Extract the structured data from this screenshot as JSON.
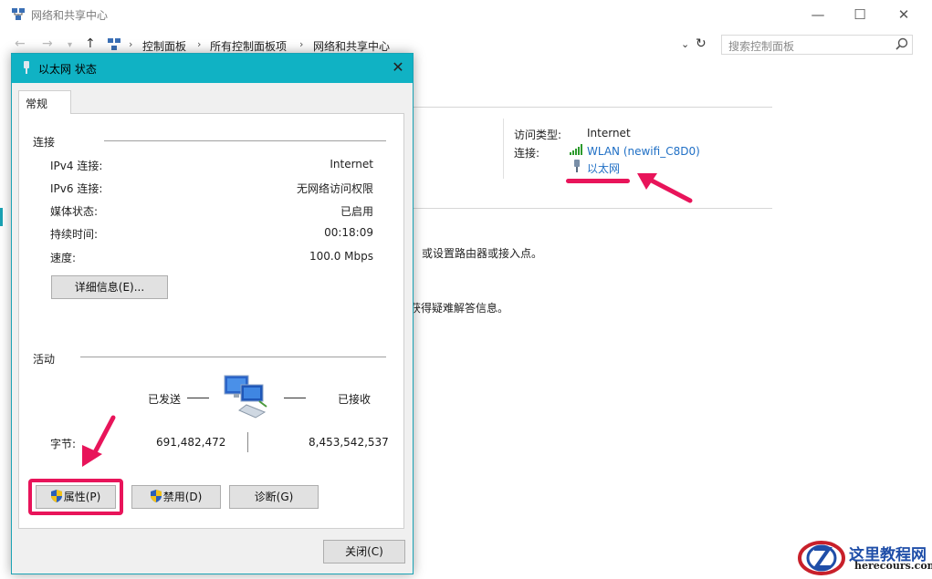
{
  "window": {
    "title": "网络和共享中心",
    "controls": [
      "—",
      "☐",
      "✕"
    ]
  },
  "addressbar": {
    "crumbs": [
      "控制面板",
      "所有控制面板项",
      "网络和共享中心"
    ],
    "search_placeholder": "搜索控制面板"
  },
  "background": {
    "access_type_label": "访问类型:",
    "access_type_value": "Internet",
    "connection_label": "连接:",
    "wlan_link": "WLAN (newifi_C8D0)",
    "ethernet_link": "以太网",
    "line1": "或设置路由器或接入点。",
    "line2": "获得疑难解答信息。"
  },
  "dialog": {
    "title": "以太网 状态",
    "tab": "常规",
    "connection_group": "连接",
    "rows": [
      {
        "label": "IPv4 连接:",
        "value": "Internet"
      },
      {
        "label": "IPv6 连接:",
        "value": "无网络访问权限"
      },
      {
        "label": "媒体状态:",
        "value": "已启用"
      },
      {
        "label": "持续时间:",
        "value": "00:18:09"
      },
      {
        "label": "速度:",
        "value": "100.0 Mbps"
      }
    ],
    "details_button": "详细信息(E)...",
    "activity_group": "活动",
    "sent_label": "已发送",
    "received_label": "已接收",
    "bytes_label": "字节:",
    "bytes_sent": "691,482,472",
    "bytes_received": "8,453,542,537",
    "properties_button": "属性(P)",
    "disable_button": "禁用(D)",
    "diagnose_button": "诊断(G)",
    "close_button": "关闭(C)"
  },
  "watermark": {
    "title": "这里教程网",
    "url": "herecours.com"
  },
  "colors": {
    "dialog_title": "#10b2c4",
    "highlight": "#e8145a",
    "link": "#1f6fc5"
  }
}
